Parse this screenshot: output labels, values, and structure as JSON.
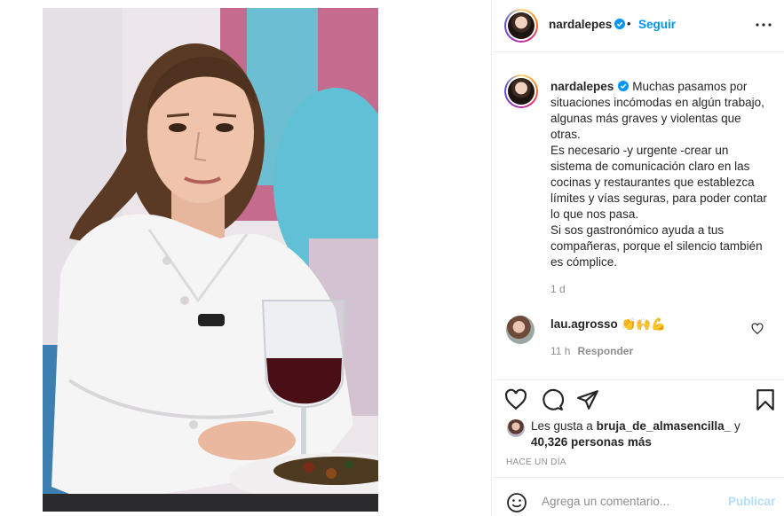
{
  "post": {
    "author": "nardalepes",
    "follow_label": "Seguir",
    "dot": "•",
    "caption_lines": [
      "Muchas pasamos por situaciones incómodas en algún trabajo, algunas más graves y violentas que otras.",
      "Es necesario -y urgente -crear un sistema de comunicación claro en las cocinas y restaurantes que establezca límites y vías seguras, para poder contar lo que nos pasa.",
      "Si sos gastronómico ayuda a tus compañeras, porque el silencio también es cómplice."
    ],
    "caption_age": "1 d",
    "icons": {
      "verified": "verified-badge-icon",
      "more": "more-options-icon",
      "like": "heart-icon",
      "comment": "comment-bubble-icon",
      "share": "paper-plane-icon",
      "save": "bookmark-icon",
      "emoji": "smiley-icon"
    }
  },
  "comment": {
    "author": "lau.agrosso",
    "text": "👏🙌💪",
    "age": "11 h",
    "reply_label": "Responder"
  },
  "likes": {
    "prefix": "Les gusta a",
    "user": "bruja_de_almasencilla_",
    "conj": "y",
    "others": "40,326 personas más"
  },
  "date_label": "HACE UN DÍA",
  "composer": {
    "placeholder": "Agrega un comentario...",
    "post_label": "Publicar"
  },
  "colors": {
    "accent_blue": "#0095f6",
    "disabled_blue": "#b2dffc",
    "muted_text": "#8e8e8e",
    "text": "#262626",
    "divider": "#efefef"
  }
}
